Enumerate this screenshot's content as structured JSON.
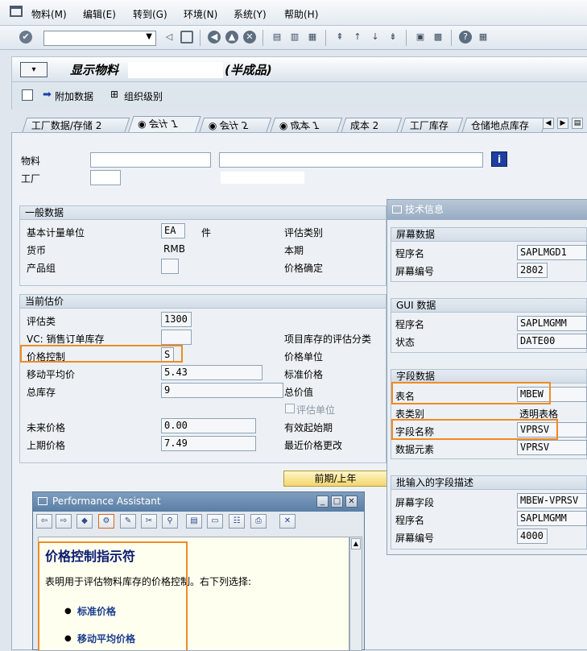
{
  "menu": {
    "items": [
      "物料(M)",
      "编辑(E)",
      "转到(G)",
      "环境(N)",
      "系统(Y)",
      "帮助(H)"
    ]
  },
  "title": {
    "text": "显示物料",
    "suffix": "(半成品)"
  },
  "app_toolbar": {
    "additional_data": "附加数据",
    "org_levels": "组织级别"
  },
  "tabs": [
    "工厂数据/存储 2",
    "会计 1",
    "会计 2",
    "成本 1",
    "成本 2",
    "工厂库存",
    "仓储地点库存"
  ],
  "header_fields": {
    "material_label": "物料",
    "plant_label": "工厂"
  },
  "general": {
    "title": "一般数据",
    "base_uom_label": "基本计量单位",
    "base_uom": "EA",
    "base_uom_text": "件",
    "currency_label": "货币",
    "currency": "RMB",
    "product_group_label": "产品组",
    "valuation_category_label": "评估类别",
    "current_period_label": "本期",
    "price_determination_label": "价格确定"
  },
  "valuation": {
    "title": "当前估价",
    "valuation_class_label": "评估类",
    "valuation_class": "1300",
    "vc_sales_label": "VC: 销售订单库存",
    "price_control_label": "价格控制",
    "price_control": "S",
    "moving_avg_label": "移动平均价",
    "moving_avg": "5.43",
    "total_stock_label": "总库存",
    "total_stock": "9",
    "proj_stock_val_label": "项目库存的评估分类",
    "price_unit_label": "价格单位",
    "standard_price_label": "标准价格",
    "total_value_label": "总价值",
    "valuation_unit_label": "评估单位",
    "future_price_label": "未来价格",
    "future_price": "0.00",
    "valid_from_label": "有效起始期",
    "prev_price_label": "上期价格",
    "prev_price": "7.49",
    "last_price_change_label": "最近价格更改",
    "period_button": "前期/上年"
  },
  "tech_info": {
    "title": "技术信息",
    "screen_data": {
      "title": "屏幕数据",
      "program_label": "程序名",
      "program": "SAPLMGD1",
      "screen_label": "屏幕编号",
      "screen": "2802"
    },
    "gui_data": {
      "title": "GUI 数据",
      "program_label": "程序名",
      "program": "SAPLMGMM",
      "status_label": "状态",
      "status": "DATE00"
    },
    "field_data": {
      "title": "字段数据",
      "table_label": "表名",
      "table": "MBEW",
      "table_type_label": "表类别",
      "table_type": "透明表格",
      "field_label": "字段名称",
      "field": "VPRSV",
      "data_element_label": "数据元素",
      "data_element": "VPRSV"
    },
    "batch_input": {
      "title": "批输入的字段描述",
      "screen_field_label": "屏幕字段",
      "screen_field": "MBEW-VPRSV",
      "program_label": "程序名",
      "program": "SAPLMGMM",
      "screen_label": "屏幕编号",
      "screen": "4000"
    }
  },
  "perf_assistant": {
    "title": "Performance Assistant",
    "heading": "价格控制指示符",
    "description": "表明用于评估物料库存的价格控制。右下列选择:",
    "options": [
      "标准价格",
      "移动平均价格"
    ]
  },
  "colors": {
    "highlight": "#f08a24",
    "title_blue": "#0a1a70",
    "link_blue": "#1a3c8c"
  }
}
